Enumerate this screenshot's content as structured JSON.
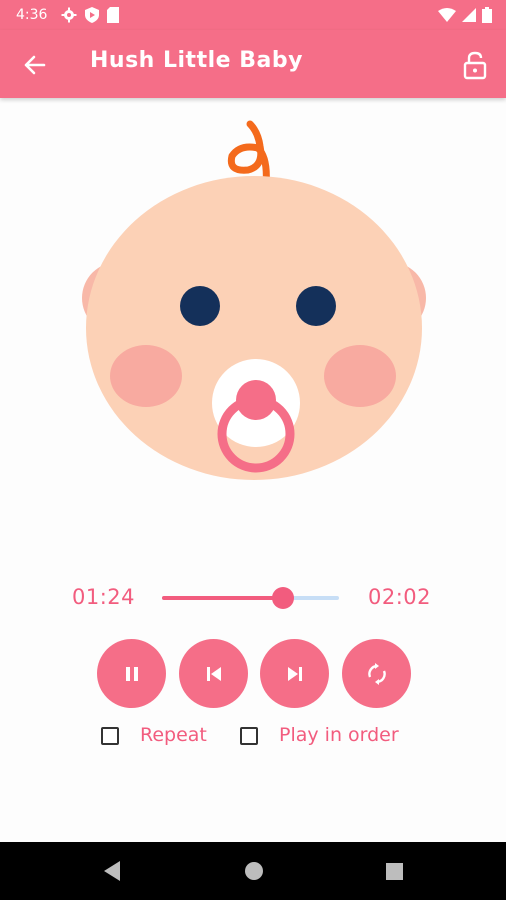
{
  "status_bar": {
    "time": "4:36",
    "icons": [
      "gear-icon",
      "shield-play-icon",
      "sd-card-icon",
      "wifi-icon",
      "signal-icon",
      "battery-icon"
    ]
  },
  "app_bar": {
    "title": "Hush Little Baby",
    "back_icon": "arrow-left-icon",
    "lock_icon": "unlock-icon"
  },
  "player": {
    "current_time": "01:24",
    "duration": "02:02",
    "progress": 0.685
  },
  "controls": [
    {
      "name": "pause-button",
      "icon": "pause-icon"
    },
    {
      "name": "previous-button",
      "icon": "skip-previous-icon"
    },
    {
      "name": "next-button",
      "icon": "skip-next-icon"
    },
    {
      "name": "shuffle-button",
      "icon": "sync-icon"
    }
  ],
  "options": {
    "repeat_label": "Repeat",
    "repeat_checked": false,
    "play_in_order_label": "Play in order",
    "play_in_order_checked": false
  },
  "colors": {
    "primary": "#f56e88",
    "accent_text": "#f25c7e",
    "track_inactive": "#c7def6"
  },
  "nav_bar": {
    "icons": [
      "back-triangle-icon",
      "home-circle-icon",
      "recents-square-icon"
    ]
  }
}
